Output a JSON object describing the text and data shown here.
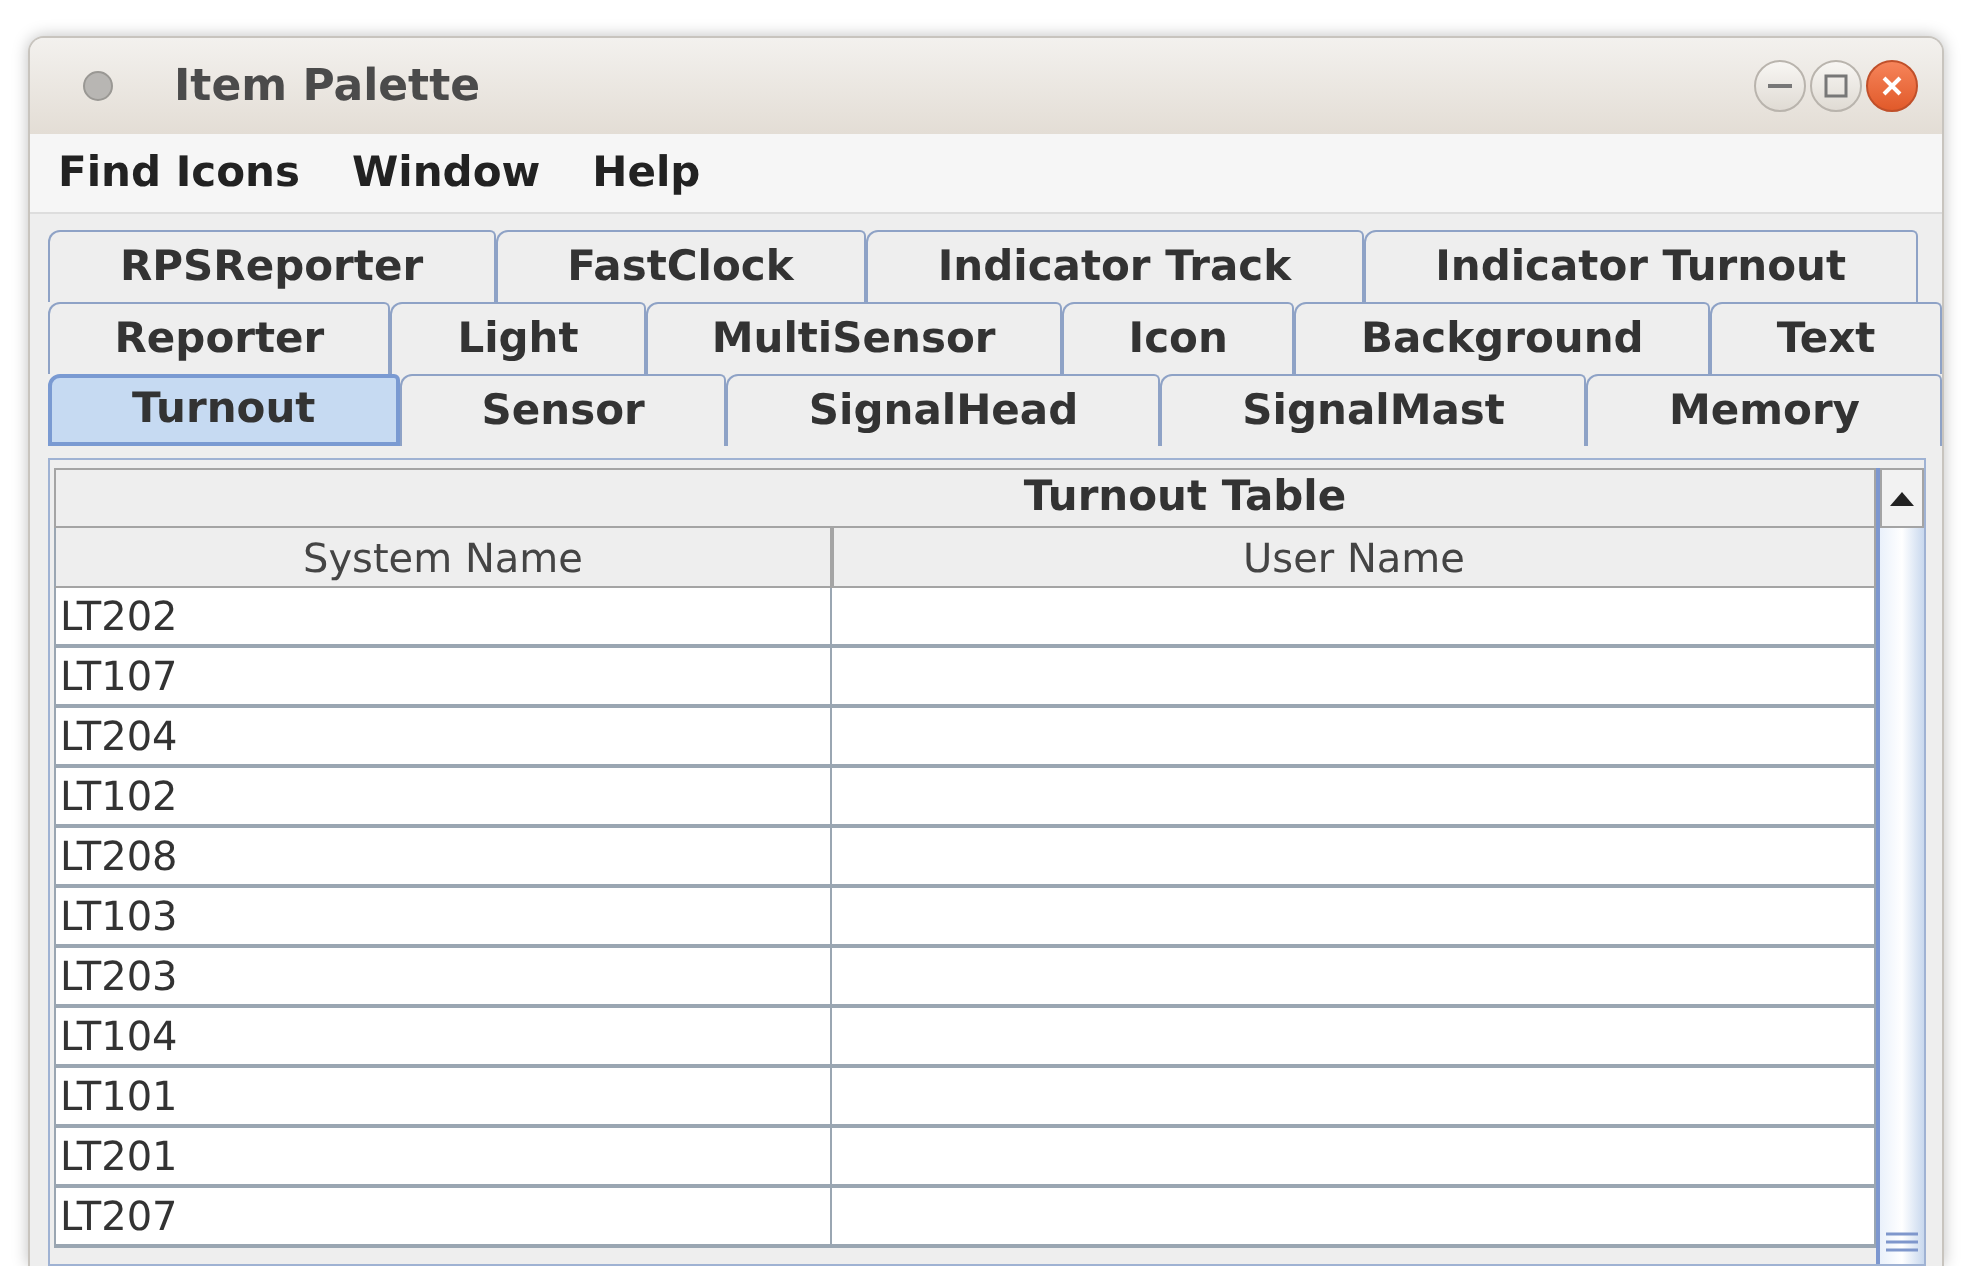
{
  "window": {
    "title": "Item Palette"
  },
  "menu": [
    "Find Icons",
    "Window",
    "Help"
  ],
  "tab_rows": [
    [
      {
        "label": "RPSReporter",
        "selected": false
      },
      {
        "label": "FastClock",
        "selected": false
      },
      {
        "label": "Indicator Track",
        "selected": false
      },
      {
        "label": "Indicator Turnout",
        "selected": false
      }
    ],
    [
      {
        "label": "Reporter",
        "selected": false
      },
      {
        "label": "Light",
        "selected": false
      },
      {
        "label": "MultiSensor",
        "selected": false
      },
      {
        "label": "Icon",
        "selected": false
      },
      {
        "label": "Background",
        "selected": false
      },
      {
        "label": "Text",
        "selected": false
      }
    ],
    [
      {
        "label": "Turnout",
        "selected": true
      },
      {
        "label": "Sensor",
        "selected": false
      },
      {
        "label": "SignalHead",
        "selected": false
      },
      {
        "label": "SignalMast",
        "selected": false
      },
      {
        "label": "Memory",
        "selected": false
      }
    ]
  ],
  "table": {
    "title": "Turnout Table",
    "columns": [
      "System Name",
      "User Name"
    ],
    "rows": [
      [
        "LT202",
        ""
      ],
      [
        "LT107",
        ""
      ],
      [
        "LT204",
        ""
      ],
      [
        "LT102",
        ""
      ],
      [
        "LT208",
        ""
      ],
      [
        "LT103",
        ""
      ],
      [
        "LT203",
        ""
      ],
      [
        "LT104",
        ""
      ],
      [
        "LT101",
        ""
      ],
      [
        "LT201",
        ""
      ],
      [
        "LT207",
        ""
      ]
    ]
  }
}
